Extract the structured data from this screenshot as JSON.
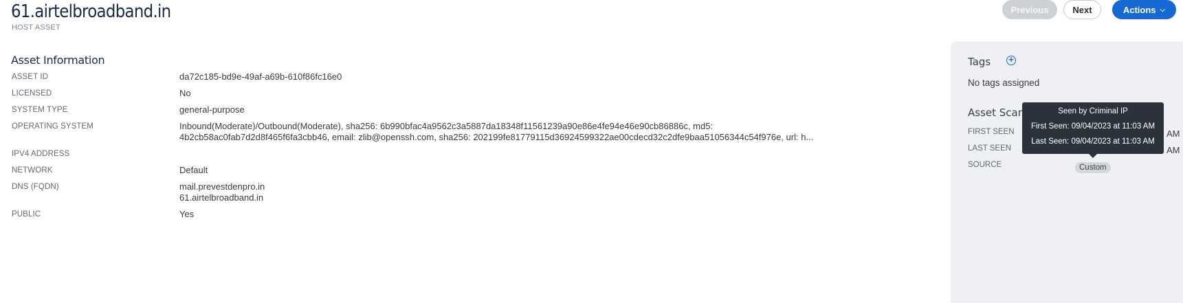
{
  "header": {
    "title": "61.airtelbroadband.in",
    "subtitle": "HOST ASSET",
    "previous_label": "Previous",
    "next_label": "Next",
    "actions_label": "Actions"
  },
  "asset_info": {
    "section_title": "Asset Information",
    "rows": [
      {
        "label": "ASSET ID",
        "value": "da72c185-bd9e-49af-a69b-610f86fc16e0"
      },
      {
        "label": "LICENSED",
        "value": "No"
      },
      {
        "label": "SYSTEM TYPE",
        "value": "general-purpose"
      },
      {
        "label": "OPERATING SYSTEM",
        "value": "Inbound(Moderate)/Outbound(Moderate), sha256: 6b990bfac4a9562c3a5887da18348f11561239a90e86e4fe94e46e90cb86886c, md5:",
        "value2": "4b2cb58ac0fab7d2d8f465f6fa3cbb46, email: zlib@openssh.com, sha256: 202199fe81779115d36924599322ae00cdecd32c2dfe9baa51056344c54f976e, url: h..."
      },
      {
        "label": "IPV4 ADDRESS",
        "value": ""
      },
      {
        "label": "NETWORK",
        "value": "Default"
      },
      {
        "label": "DNS (FQDN)",
        "value": "mail.prevestdenpro.in",
        "value2": "61.airtelbroadband.in"
      },
      {
        "label": "PUBLIC",
        "value": "Yes"
      }
    ]
  },
  "tags": {
    "heading": "Tags",
    "empty_text": "No tags assigned"
  },
  "asset_scan": {
    "heading": "Asset Scan",
    "first_seen_label": "FIRST SEEN",
    "last_seen_label": "LAST SEEN",
    "source_label": "SOURCE",
    "first_seen_suffix": "AM",
    "last_seen_suffix": "AM",
    "source_badge": "Custom"
  },
  "tooltip": {
    "title": "Seen by Criminal IP",
    "first_seen": "First Seen: 09/04/2023 at 11:03 AM",
    "last_seen": "Last Seen: 09/04/2023 at 11:03 AM"
  }
}
